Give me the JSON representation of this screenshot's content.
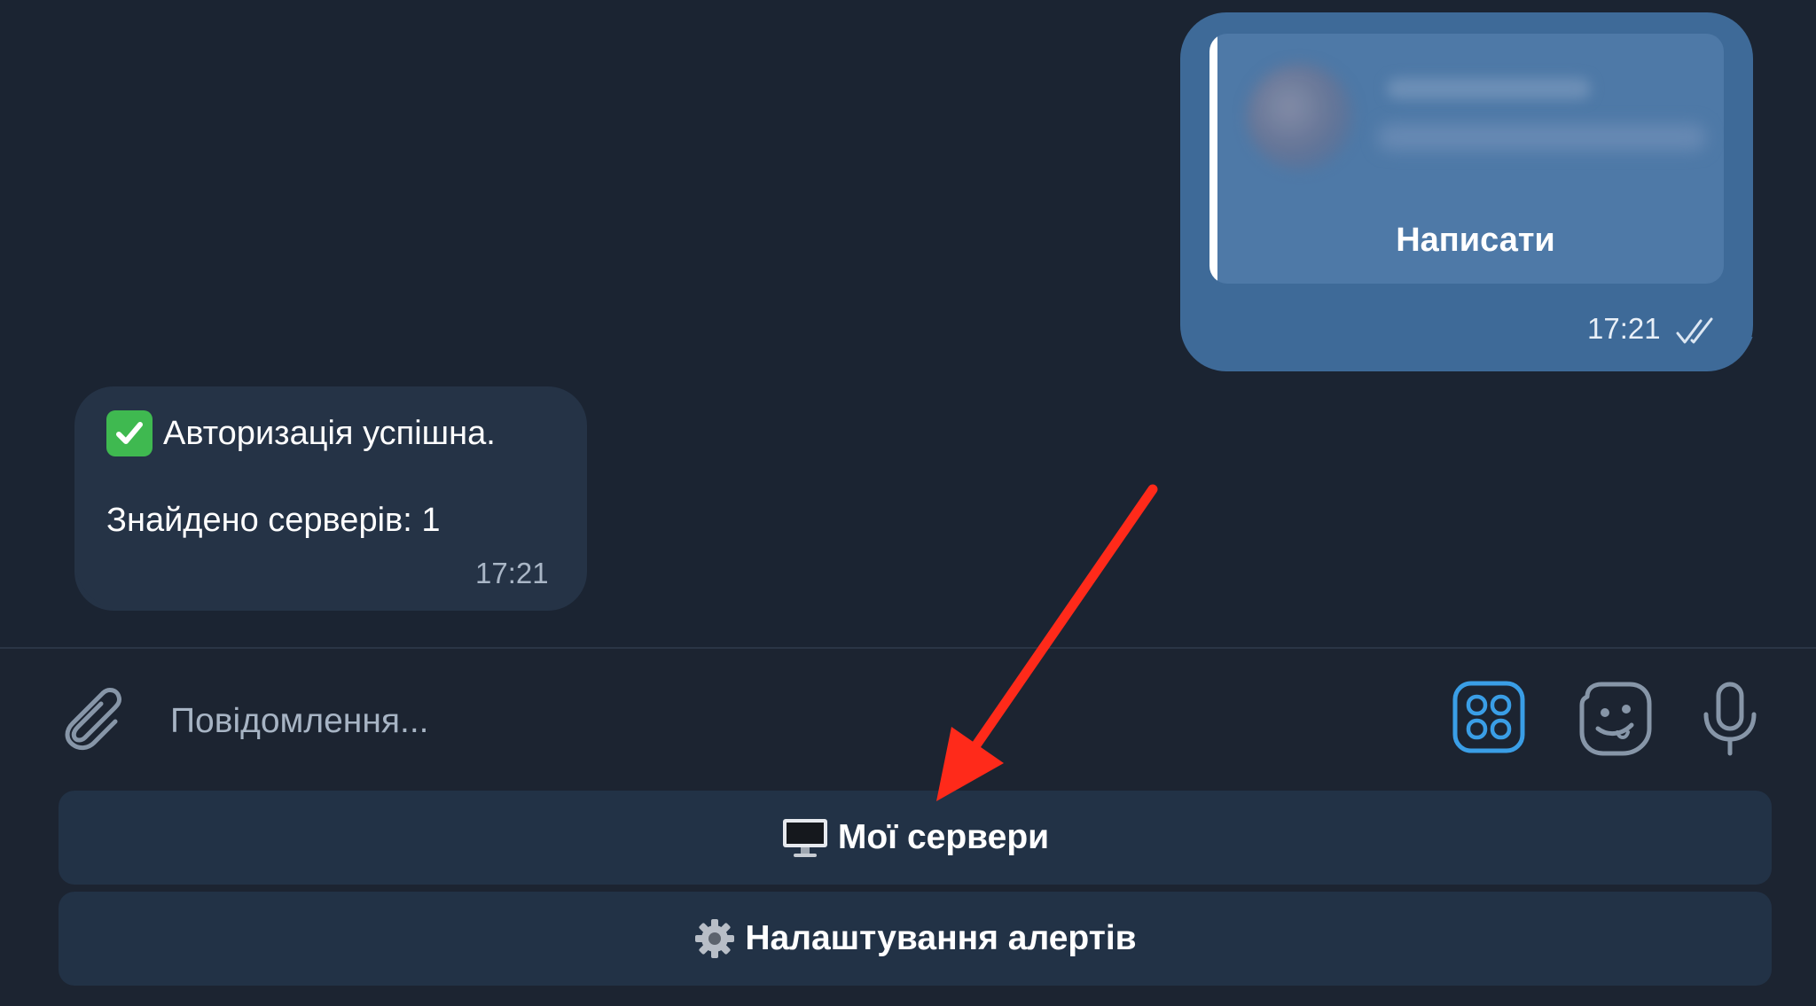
{
  "colors": {
    "background": "#1b2432",
    "outgoing_bubble": "#3e6a98",
    "incoming_bubble": "#253346",
    "keyboard_button": "#223246",
    "accent_blue": "#3a9ee6",
    "annotation_arrow": "#ff2a1a"
  },
  "outgoing_message": {
    "button_label": "Написати",
    "time": "17:21",
    "status_icon": "double-check-icon"
  },
  "incoming_message": {
    "emoji": "check-mark-button-emoji",
    "line1": "Авторизація успішна.",
    "line2": "Знайдено серверів: 1",
    "time": "17:21"
  },
  "composer": {
    "placeholder": "Повідомлення...",
    "icons": [
      "paperclip-icon",
      "bot-apps-icon",
      "sticker-icon",
      "microphone-icon"
    ]
  },
  "keyboard": {
    "buttons": [
      {
        "icon": "desktop-computer-icon",
        "label": "Мої сервери"
      },
      {
        "icon": "gear-icon",
        "label": "Налаштування алертів"
      }
    ]
  }
}
